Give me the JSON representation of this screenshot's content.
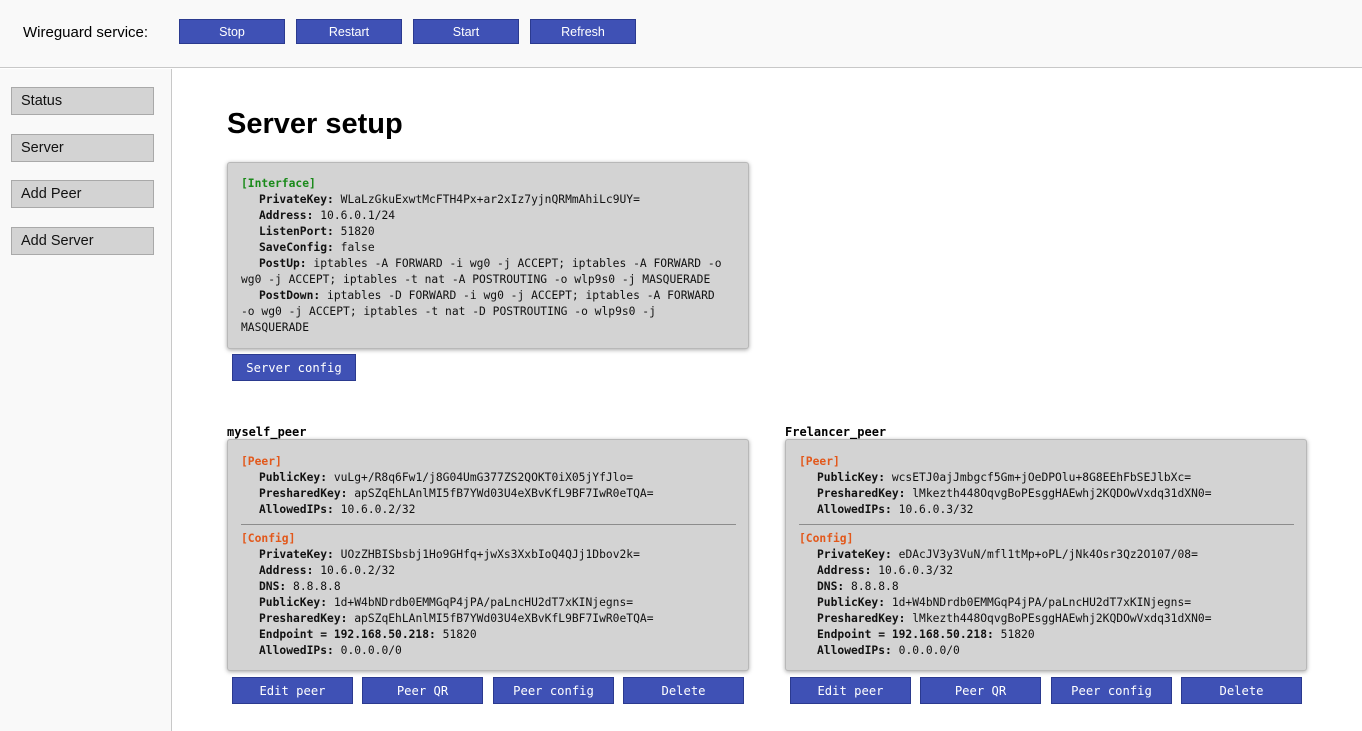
{
  "topbar": {
    "label": "Wireguard service:",
    "buttons": [
      "Stop",
      "Restart",
      "Start",
      "Refresh"
    ]
  },
  "sidebar": {
    "items": [
      "Status",
      "Server",
      "Add Peer",
      "Add Server"
    ]
  },
  "main": {
    "title": "Server setup",
    "server": {
      "section": "[Interface]",
      "keys": {
        "private_key": "PrivateKey:",
        "address": "Address:",
        "listen_port": "ListenPort:",
        "save_config": "SaveConfig:",
        "post_up": "PostUp:",
        "post_down": "PostDown:"
      },
      "private_key": "WLaLzGkuExwtMcFTH4Px+ar2xIz7yjnQRMmAhiLc9UY=",
      "address": "10.6.0.1/24",
      "listen_port": "51820",
      "save_config": "false",
      "post_up_1": "iptables -A FORWARD -i wg0 -j ACCEPT; iptables -A FORWARD -o",
      "post_up_2": "wg0 -j ACCEPT; iptables -t nat -A POSTROUTING -o wlp9s0 -j MASQUERADE",
      "post_down_1": "iptables -D FORWARD -i wg0 -j ACCEPT; iptables -A FORWARD",
      "post_down_2": "-o wg0 -j ACCEPT; iptables -t nat -D POSTROUTING -o wlp9s0 -j",
      "post_down_3": "MASQUERADE",
      "config_button": "Server config"
    },
    "peer_labels": {
      "peer_section": "[Peer]",
      "config_section": "[Config]",
      "public_key": "PublicKey:",
      "preshared_key": "PresharedKey:",
      "allowed_ips": "AllowedIPs:",
      "private_key": "PrivateKey:",
      "address": "Address:",
      "dns": "DNS:",
      "endpoint": "Endpoint = 192.168.50.218:"
    },
    "peers": [
      {
        "name": "myself_peer",
        "public_key": "vuLg+/R8q6Fw1/j8G04UmG377ZS2QOKT0iX05jYfJlo=",
        "preshared_key": "apSZqEhLAnlMI5fB7YWd03U4eXBvKfL9BF7IwR0eTQA=",
        "allowed_ips": "10.6.0.2/32",
        "cfg_private_key": "UOzZHBISbsbj1Ho9GHfq+jwXs3XxbIoQ4QJj1Dbov2k=",
        "cfg_address": "10.6.0.2/32",
        "cfg_dns": "8.8.8.8",
        "cfg_public_key": "1d+W4bNDrdb0EMMGqP4jPA/paLncHU2dT7xKINjegns=",
        "cfg_preshared_key": "apSZqEhLAnlMI5fB7YWd03U4eXBvKfL9BF7IwR0eTQA=",
        "cfg_endpoint_port": "51820",
        "cfg_allowed_ips": "0.0.0.0/0"
      },
      {
        "name": "Frelancer_peer",
        "public_key": "wcsETJ0ajJmbgcf5Gm+jOeDPOlu+8G8EEhFbSEJlbXc=",
        "preshared_key": "lMkezth448OqvgBoPEsggHAEwhj2KQDOwVxdq31dXN0=",
        "allowed_ips": "10.6.0.3/32",
        "cfg_private_key": "eDAcJV3y3VuN/mfl1tMp+oPL/jNk4Osr3Qz2O107/08=",
        "cfg_address": "10.6.0.3/32",
        "cfg_dns": "8.8.8.8",
        "cfg_public_key": "1d+W4bNDrdb0EMMGqP4jPA/paLncHU2dT7xKINjegns=",
        "cfg_preshared_key": "lMkezth448OqvgBoPEsggHAEwhj2KQDOwVxdq31dXN0=",
        "cfg_endpoint_port": "51820",
        "cfg_allowed_ips": "0.0.0.0/0"
      }
    ],
    "peer_actions": [
      "Edit peer",
      "Peer QR",
      "Peer config",
      "Delete"
    ]
  },
  "colors": {
    "button": "#3f51b5",
    "interface_section": "#1a8a1a",
    "peer_section": "#e2581b",
    "card": "#d3d3d3"
  }
}
